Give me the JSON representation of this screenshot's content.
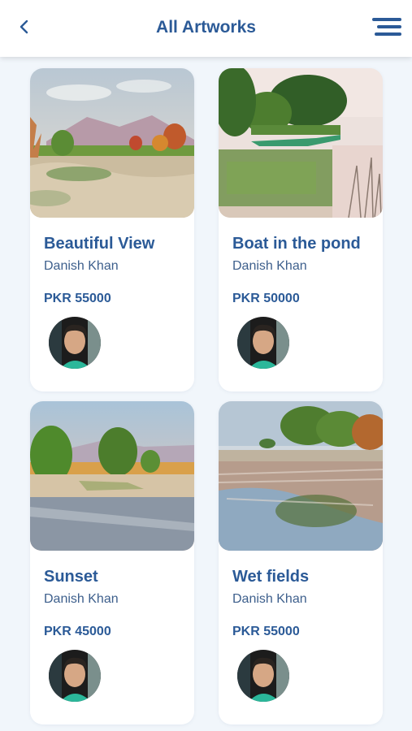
{
  "header": {
    "title": "All Artworks",
    "back_icon": "chevron-left-icon",
    "menu_icon": "hamburger-menu-icon"
  },
  "colors": {
    "accent": "#2b5a97",
    "background": "#f1f6fb",
    "card": "#ffffff"
  },
  "artworks": [
    {
      "title": "Beautiful View",
      "artist": "Danish Khan",
      "price": "PKR 55000"
    },
    {
      "title": "Boat in the pond",
      "artist": "Danish Khan",
      "price": "PKR 50000"
    },
    {
      "title": "Sunset",
      "artist": "Danish Khan",
      "price": "PKR 45000"
    },
    {
      "title": "Wet fields",
      "artist": "Danish Khan",
      "price": "PKR 55000"
    }
  ]
}
